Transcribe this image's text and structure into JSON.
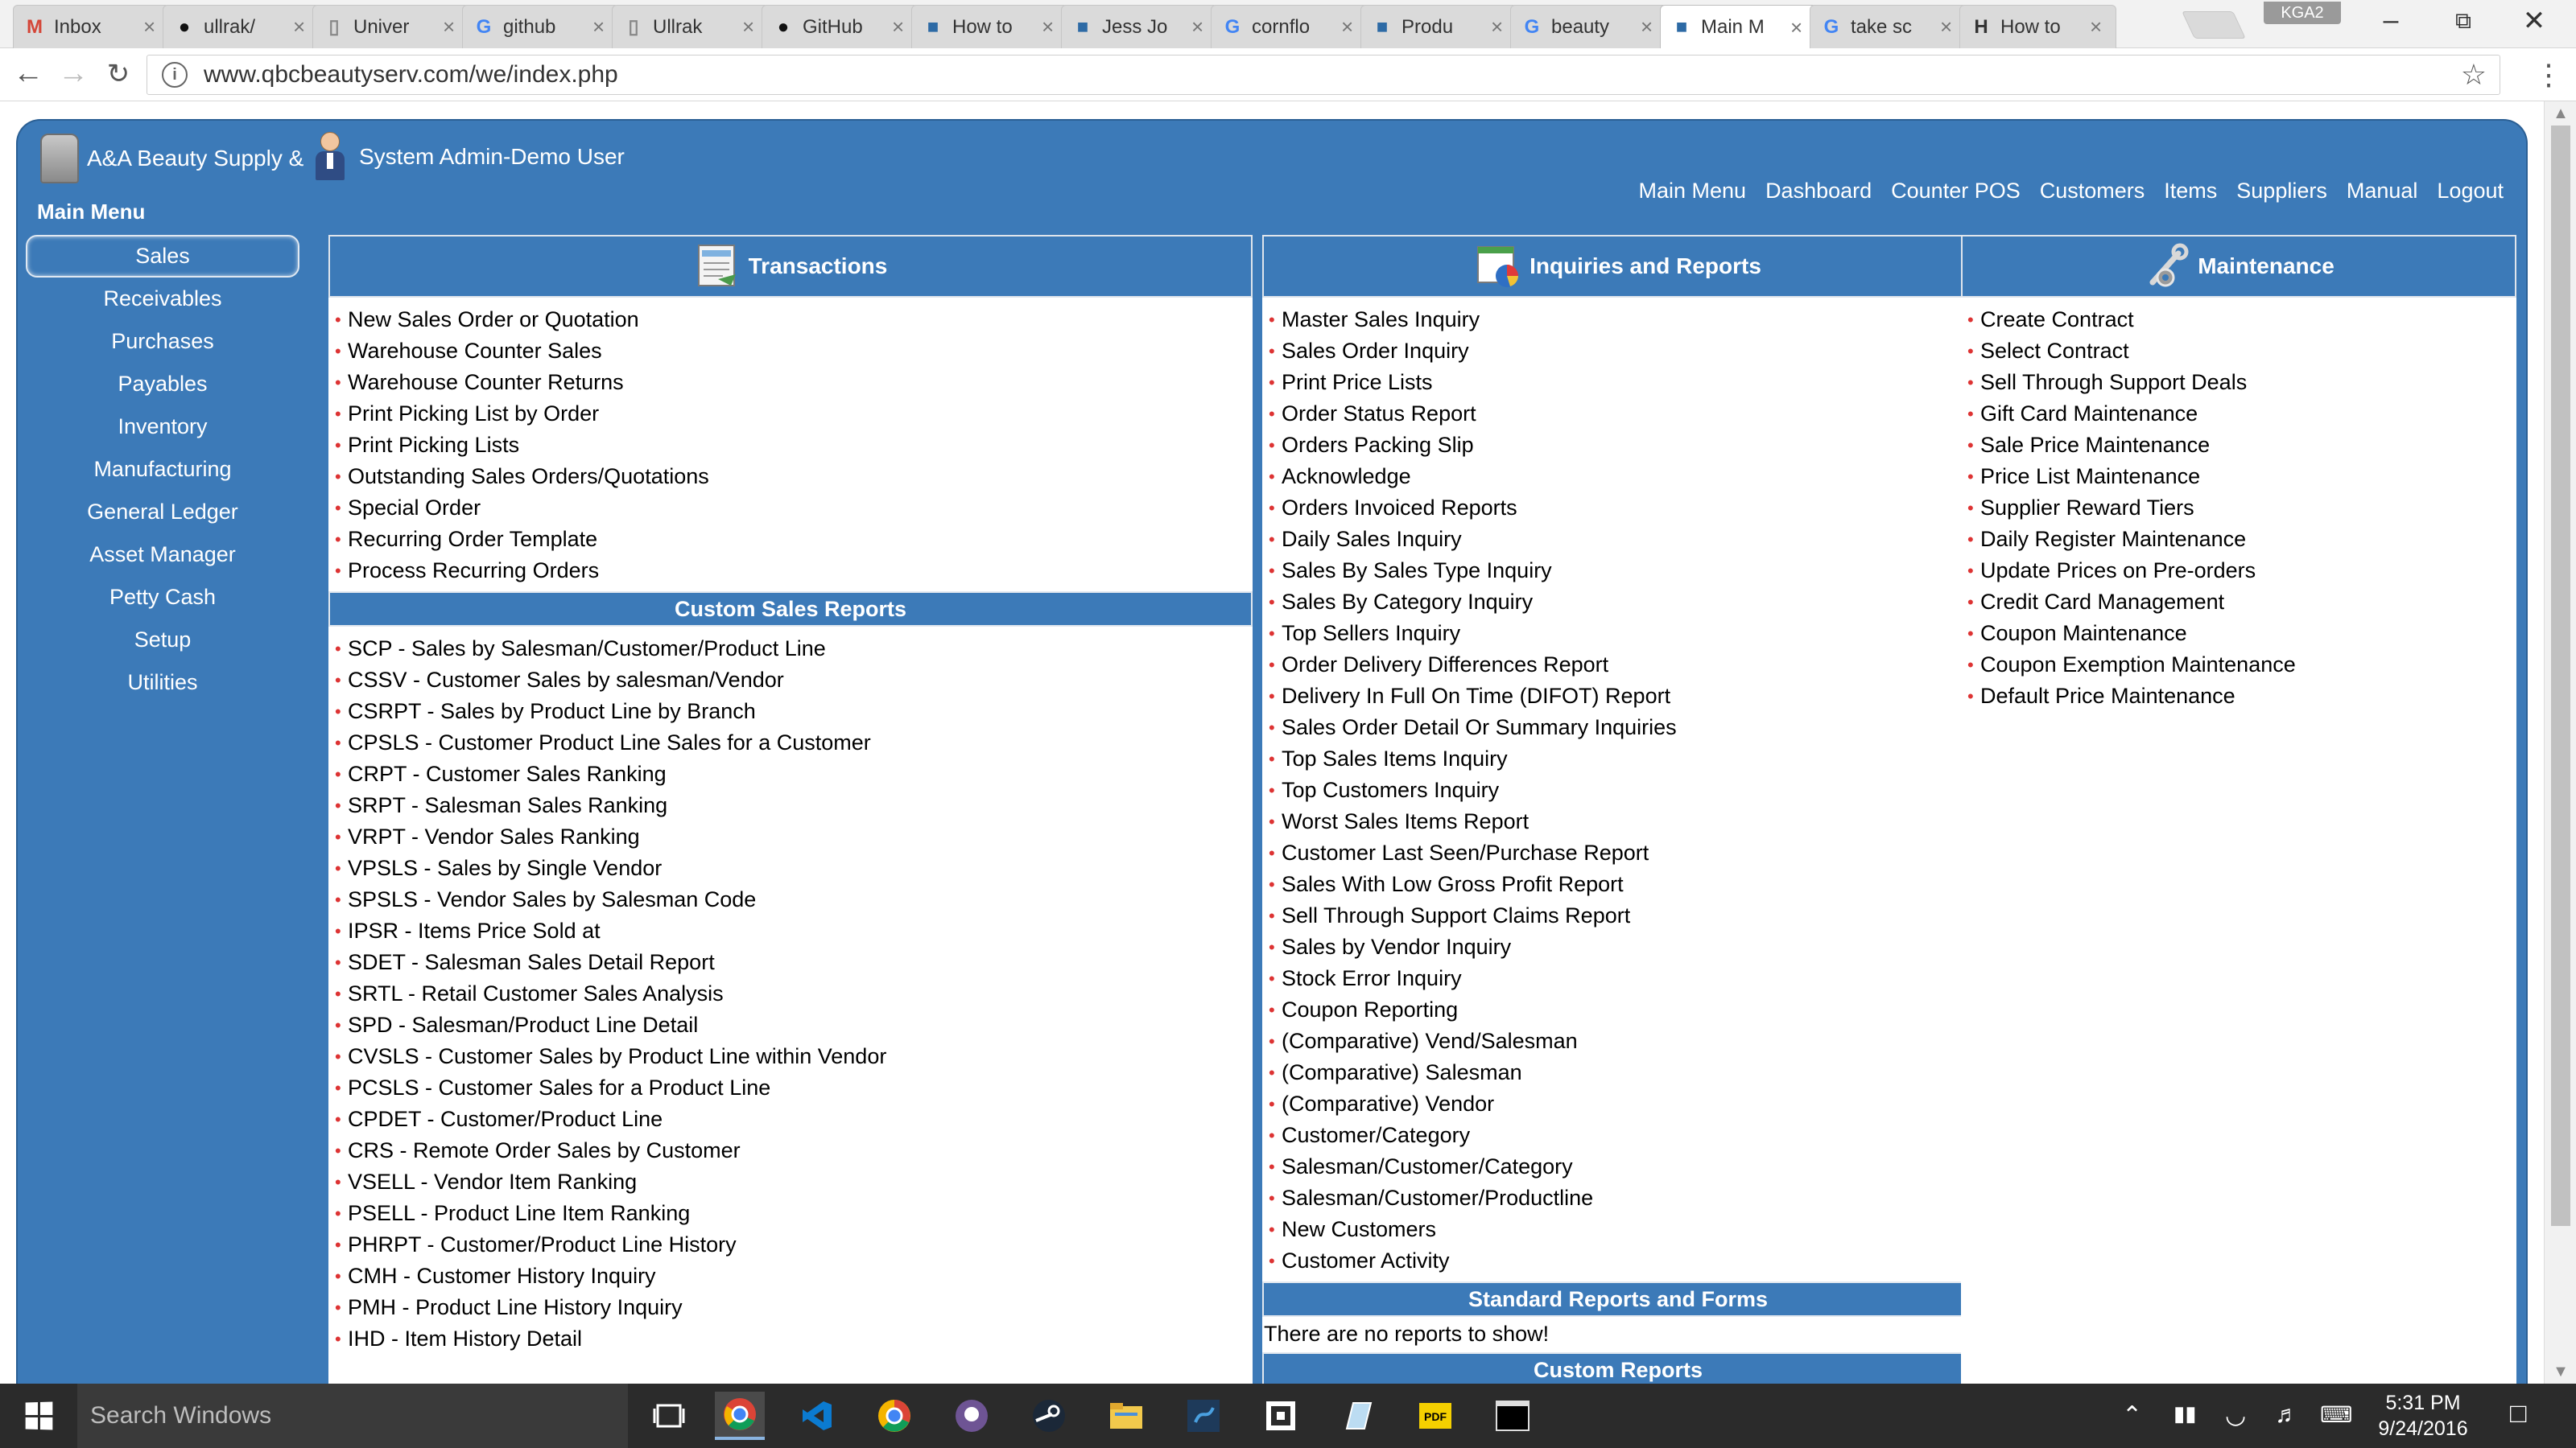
{
  "browser": {
    "tabs": [
      {
        "label": "Inbox",
        "icon": "gmail-icon"
      },
      {
        "label": "ullrak/",
        "icon": "github-icon"
      },
      {
        "label": "Univer",
        "icon": "document-icon"
      },
      {
        "label": "github",
        "icon": "google-icon"
      },
      {
        "label": "Ullrak",
        "icon": "document-icon"
      },
      {
        "label": "GitHub",
        "icon": "github-icon"
      },
      {
        "label": "How to",
        "icon": "site-icon"
      },
      {
        "label": "Jess Jo",
        "icon": "site-icon"
      },
      {
        "label": "cornflo",
        "icon": "google-icon"
      },
      {
        "label": "Produ",
        "icon": "site-icon"
      },
      {
        "label": "beauty",
        "icon": "google-icon"
      },
      {
        "label": "Main M",
        "icon": "site-icon"
      },
      {
        "label": "take sc",
        "icon": "google-icon"
      },
      {
        "label": "How to",
        "icon": "htg-icon"
      }
    ],
    "active_tab": 11,
    "profile": "KGA2",
    "url": "www.qbcbeautyserv.com/we/index.php"
  },
  "app": {
    "company": "A&A Beauty Supply &",
    "user": "System Admin-Demo User",
    "menu_title": "Main Menu",
    "top_nav": [
      "Main Menu",
      "Dashboard",
      "Counter POS",
      "Customers",
      "Items",
      "Suppliers",
      "Manual",
      "Logout"
    ],
    "sidebar": [
      "Sales",
      "Receivables",
      "Purchases",
      "Payables",
      "Inventory",
      "Manufacturing",
      "General Ledger",
      "Asset Manager",
      "Petty Cash",
      "Setup",
      "Utilities"
    ],
    "sidebar_active": "Sales",
    "transactions": {
      "title": "Transactions",
      "items": [
        "New Sales Order or Quotation",
        "Warehouse Counter Sales",
        "Warehouse Counter Returns",
        "Print Picking List by Order",
        "Print Picking Lists",
        "Outstanding Sales Orders/Quotations",
        "Special Order",
        "Recurring Order Template",
        "Process Recurring Orders"
      ],
      "custom_title": "Custom Sales Reports",
      "custom_items": [
        "SCP - Sales by Salesman/Customer/Product Line",
        "CSSV - Customer Sales by salesman/Vendor",
        "CSRPT - Sales by Product Line by Branch",
        "CPSLS - Customer Product Line Sales for a Customer",
        "CRPT - Customer Sales Ranking",
        "SRPT - Salesman Sales Ranking",
        "VRPT - Vendor Sales Ranking",
        "VPSLS - Sales by Single Vendor",
        "SPSLS - Vendor Sales by Salesman Code",
        "IPSR - Items Price Sold at",
        "SDET - Salesman Sales Detail Report",
        "SRTL - Retail Customer Sales Analysis",
        "SPD - Salesman/Product Line Detail",
        "CVSLS - Customer Sales by Product Line within Vendor",
        "PCSLS - Customer Sales for a Product Line",
        "CPDET - Customer/Product Line",
        "CRS - Remote Order Sales by Customer",
        "VSELL - Vendor Item Ranking",
        "PSELL - Product Line Item Ranking",
        "PHRPT - Customer/Product Line History",
        "CMH - Customer History Inquiry",
        "PMH - Product Line History Inquiry",
        "IHD - Item History Detail"
      ]
    },
    "inquiries": {
      "title": "Inquiries and Reports",
      "items": [
        "Master Sales Inquiry",
        "Sales Order Inquiry",
        "Print Price Lists",
        "Order Status Report",
        "Orders Packing Slip",
        "Acknowledge",
        "Orders Invoiced Reports",
        "Daily Sales Inquiry",
        "Sales By Sales Type Inquiry",
        "Sales By Category Inquiry",
        "Top Sellers Inquiry",
        "Order Delivery Differences Report",
        "Delivery In Full On Time (DIFOT) Report",
        "Sales Order Detail Or Summary Inquiries",
        "Top Sales Items Inquiry",
        "Top Customers Inquiry",
        "Worst Sales Items Report",
        "Customer Last Seen/Purchase Report",
        "Sales With Low Gross Profit Report",
        "Sell Through Support Claims Report",
        "Sales by Vendor Inquiry",
        "Stock Error Inquiry",
        "Coupon Reporting",
        "(Comparative) Vend/Salesman",
        "(Comparative) Salesman",
        "(Comparative) Vendor",
        "Customer/Category",
        "Salesman/Customer/Category",
        "Salesman/Customer/Productline",
        "New Customers",
        "Customer Activity"
      ],
      "standard_title": "Standard Reports and Forms",
      "no_reports": "There are no reports to show!",
      "custom_title": "Custom Reports"
    },
    "maintenance": {
      "title": "Maintenance",
      "items": [
        "Create Contract",
        "Select Contract",
        "Sell Through Support Deals",
        "Gift Card Maintenance",
        "Sale Price Maintenance",
        "Price List Maintenance",
        "Supplier Reward Tiers",
        "Daily Register Maintenance",
        "Update Prices on Pre-orders",
        "Credit Card Management",
        "Coupon Maintenance",
        "Coupon Exemption Maintenance",
        "Default Price Maintenance"
      ]
    }
  },
  "taskbar": {
    "search_placeholder": "Search Windows",
    "time": "5:31 PM",
    "date": "9/24/2016"
  },
  "colors": {
    "theme_blue": "#3c7ab8",
    "bullet_red": "#dd3333"
  }
}
